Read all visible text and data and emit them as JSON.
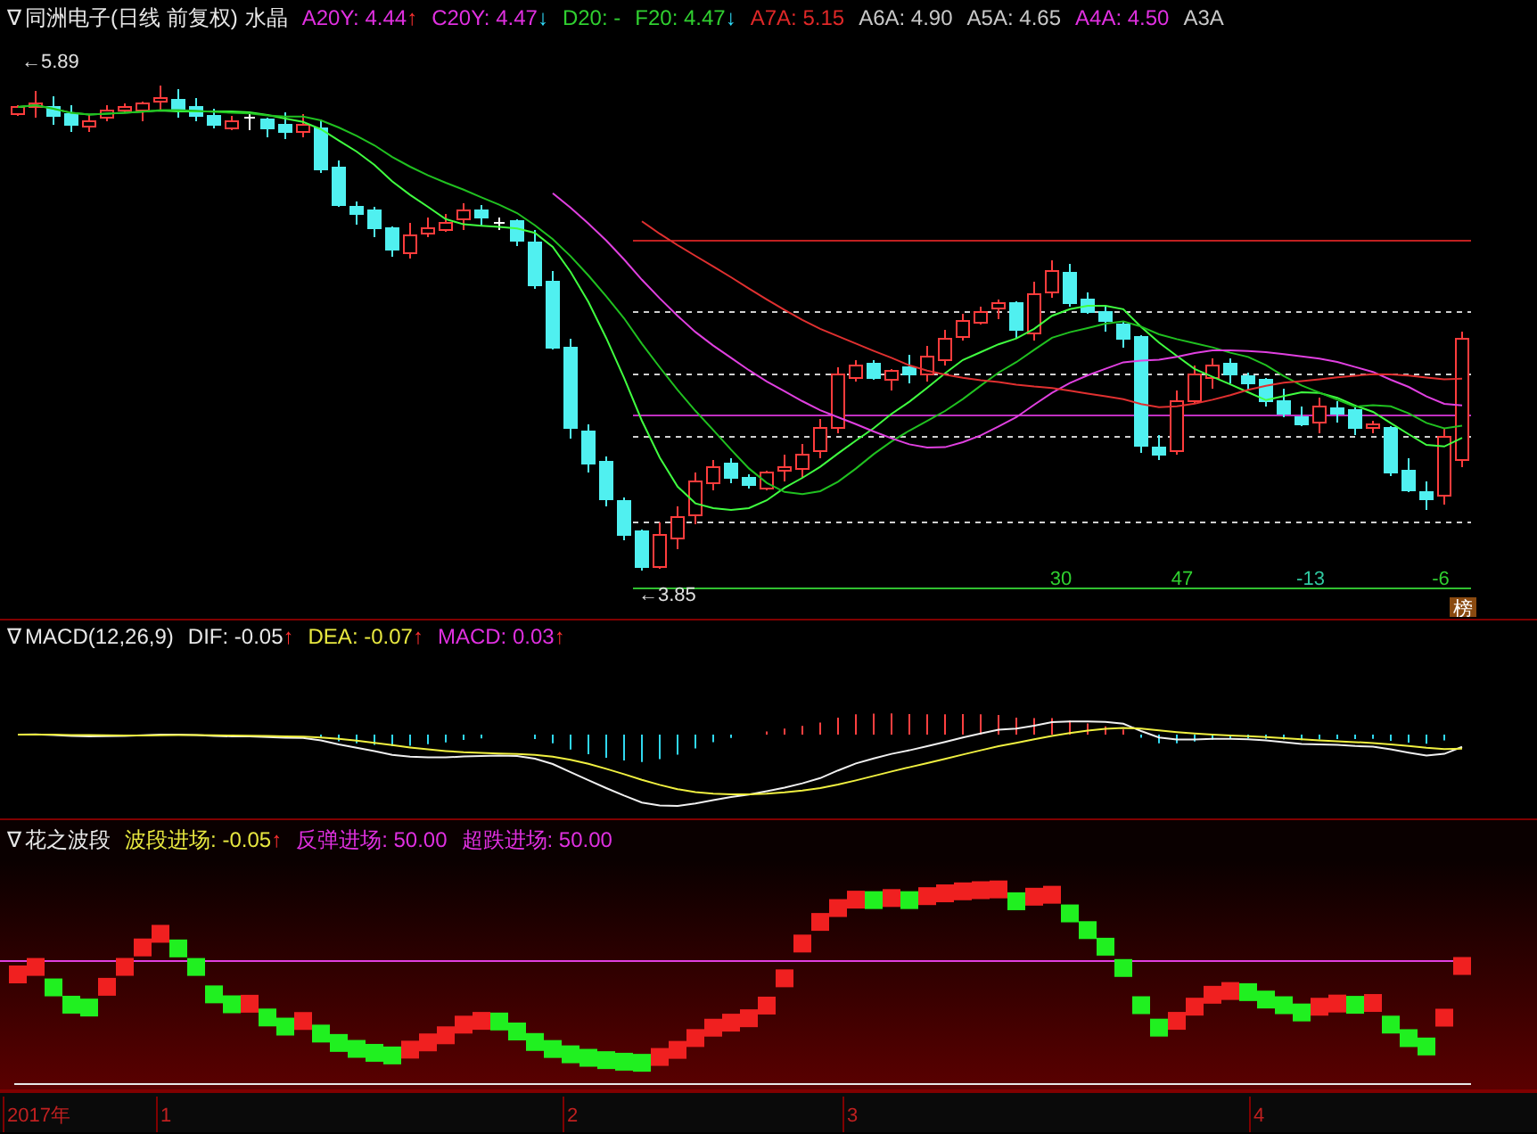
{
  "main_panel": {
    "toggle": "∇",
    "title": "同洲电子(日线 前复权)",
    "indicator": "水晶",
    "readings": [
      {
        "label": "A20Y: 4.44",
        "color": "#e030e0",
        "kind": "rising",
        "arrow": "↑"
      },
      {
        "label": "C20Y: 4.47",
        "color": "#e030e0",
        "kind": "falling",
        "arrow": "↓"
      },
      {
        "label": "D20: -",
        "color": "#30d030",
        "kind": "plain"
      },
      {
        "label": "F20: 4.47",
        "color": "#30d030",
        "kind": "falling",
        "arrow": "↓"
      },
      {
        "label": "A7A: 5.15",
        "color": "#e02828",
        "kind": "plain"
      },
      {
        "label": "A6A: 4.90",
        "color": "#c8c8c8",
        "kind": "plain"
      },
      {
        "label": "A5A: 4.65",
        "color": "#c8c8c8",
        "kind": "plain"
      },
      {
        "label": "A4A: 4.50",
        "color": "#e030e0",
        "kind": "plain"
      },
      {
        "label": "A3A",
        "color": "#c8c8c8",
        "kind": "plain"
      }
    ],
    "high_label": "←5.89",
    "low_label": "←3.85",
    "counts": [
      {
        "text": "30",
        "color": "#30d030"
      },
      {
        "text": "47",
        "color": "#30d030"
      },
      {
        "text": "-13",
        "color": "#30c8a0"
      },
      {
        "text": "-6",
        "color": "#30d030"
      }
    ],
    "badge": "榜"
  },
  "macd_panel": {
    "toggle": "∇",
    "title": "MACD(12,26,9)",
    "readings": [
      {
        "label": "DIF: -0.05",
        "color": "#e8e8e8",
        "kind": "rising",
        "arrow": "↑"
      },
      {
        "label": "DEA: -0.07",
        "color": "#e8e840",
        "kind": "rising",
        "arrow": "↑"
      },
      {
        "label": "MACD: 0.03",
        "color": "#e030e0",
        "kind": "rising",
        "arrow": "↑"
      }
    ]
  },
  "wave_panel": {
    "toggle": "∇",
    "title": "花之波段",
    "readings": [
      {
        "label": "波段进场: -0.05",
        "color": "#e8e840",
        "kind": "rising",
        "arrow": "↑"
      },
      {
        "label": "反弹进场: 50.00",
        "color": "#e030e0",
        "kind": "plain"
      },
      {
        "label": "超跌进场: 50.00",
        "color": "#e030e0",
        "kind": "plain"
      }
    ]
  },
  "time_axis": {
    "labels": [
      "2017年",
      "1",
      "2",
      "3",
      "4"
    ]
  }
}
